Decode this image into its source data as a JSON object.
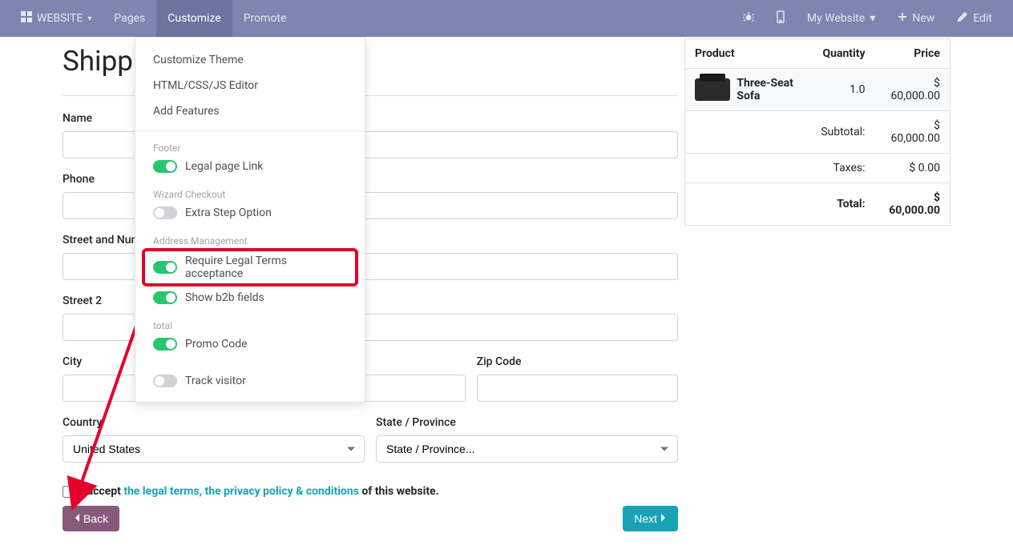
{
  "navbar": {
    "website_label": "WEBSITE",
    "pages_label": "Pages",
    "customize_label": "Customize",
    "promote_label": "Promote",
    "my_website_label": "My Website",
    "new_label": "New",
    "edit_label": "Edit"
  },
  "page": {
    "title": "Shippin"
  },
  "form": {
    "name_label": "Name",
    "phone_label": "Phone",
    "street_number_label": "Street and Number",
    "street2_label": "Street 2",
    "city_label": "City",
    "zip_label": "Zip Code",
    "country_label": "Country",
    "state_label": "State / Province",
    "country_value": "United States",
    "state_value": "State / Province..."
  },
  "accept": {
    "prefix": "I accept ",
    "link_text": "the legal terms, the privacy policy & conditions",
    "suffix": " of this website."
  },
  "buttons": {
    "back": "Back",
    "next": "Next"
  },
  "order": {
    "headers": {
      "product": "Product",
      "quantity": "Quantity",
      "price": "Price"
    },
    "items": [
      {
        "name": "Three-Seat Sofa",
        "qty": "1.0",
        "price": "$ 60,000.00"
      }
    ],
    "subtotal_label": "Subtotal:",
    "subtotal_value": "$ 60,000.00",
    "taxes_label": "Taxes:",
    "taxes_value": "$ 0.00",
    "total_label": "Total:",
    "total_value": "$ 60,000.00"
  },
  "dropdown": {
    "customize_theme": "Customize Theme",
    "html_editor": "HTML/CSS/JS Editor",
    "add_features": "Add Features",
    "footer_header": "Footer",
    "legal_page_link": "Legal page Link",
    "wizard_header": "Wizard Checkout",
    "extra_step": "Extra Step Option",
    "address_header": "Address Management",
    "require_legal": "Require Legal Terms acceptance",
    "show_b2b": "Show b2b fields",
    "total_header": "total",
    "promo_code": "Promo Code",
    "track_visitor": "Track visitor"
  },
  "annotation": {
    "arrow_color": "#e4002b"
  }
}
